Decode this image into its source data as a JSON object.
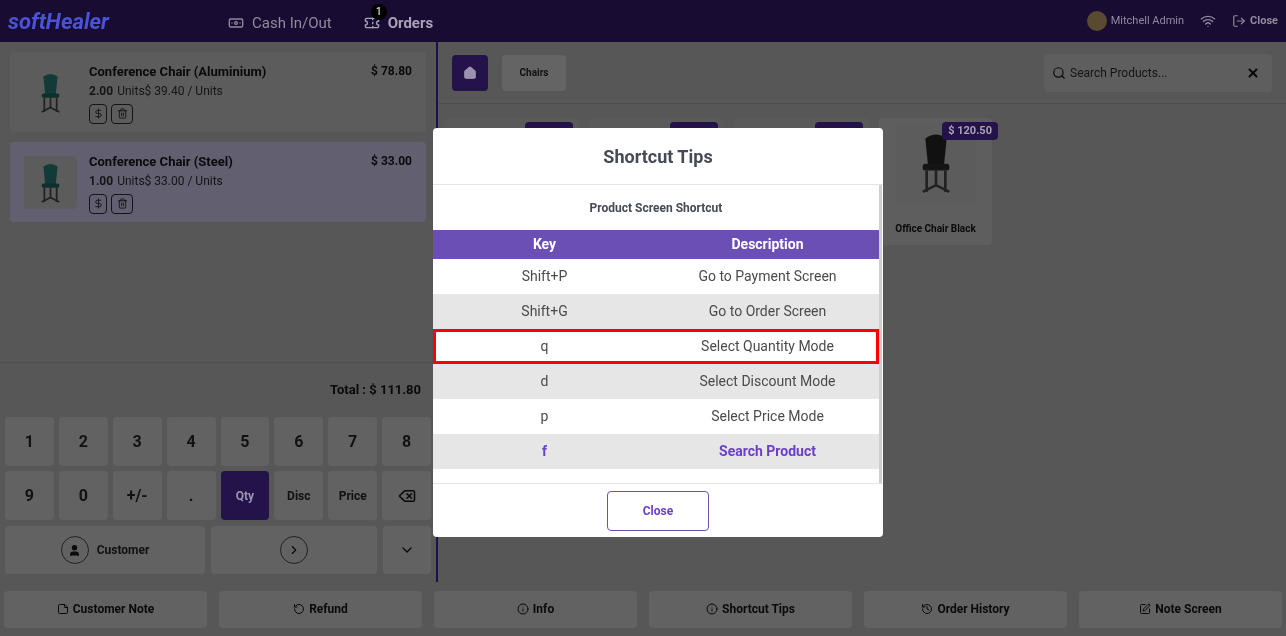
{
  "top_bar": {
    "logo": "softHealer",
    "nav": [
      {
        "label": "Cash In/Out",
        "kind": "cash",
        "active": false
      },
      {
        "label": "Orders",
        "kind": "orders",
        "badge": "1",
        "active": true
      }
    ],
    "user": "Mitchell Admin",
    "close": "Close"
  },
  "order_lines": [
    {
      "name": "Conference Chair (Aluminium)",
      "qty": "2.00",
      "unit_price": "Units$ 39.40 / Units",
      "price": "$ 78.80",
      "selected": false
    },
    {
      "name": "Conference Chair (Steel)",
      "qty": "1.00",
      "unit_price": "Units$ 33.00 / Units",
      "price": "$ 33.00",
      "selected": true
    }
  ],
  "total": "Total : $ 111.80",
  "numpad": [
    {
      "label": "1",
      "kind": "key",
      "selected": false
    },
    {
      "label": "2",
      "kind": "key",
      "selected": false
    },
    {
      "label": "3",
      "kind": "key",
      "selected": false
    },
    {
      "label": "4",
      "kind": "key",
      "selected": false
    },
    {
      "label": "5",
      "kind": "key",
      "selected": false
    },
    {
      "label": "6",
      "kind": "key",
      "selected": false
    },
    {
      "label": "7",
      "kind": "key",
      "selected": false
    },
    {
      "label": "8",
      "kind": "key",
      "selected": false
    },
    {
      "label": "9",
      "kind": "key",
      "selected": false
    },
    {
      "label": "0",
      "kind": "key",
      "selected": false
    },
    {
      "label": "+/-",
      "kind": "key",
      "selected": false
    },
    {
      "label": ".",
      "kind": "key",
      "selected": false
    },
    {
      "label": "Qty",
      "kind": "mode",
      "selected": true
    },
    {
      "label": "Disc",
      "kind": "mode",
      "selected": false
    },
    {
      "label": "Price",
      "kind": "mode",
      "selected": false
    },
    {
      "kind": "backspace",
      "selected": false
    }
  ],
  "customer_button": "Customer",
  "categories": {
    "home_selected": true,
    "items": [
      {
        "label": "Chairs",
        "selected": false
      }
    ]
  },
  "search": {
    "placeholder": "Search Products..."
  },
  "products": [
    {
      "name": "Office Chair Black",
      "price": "$ 120.50"
    }
  ],
  "dialog": {
    "title": "Shortcut Tips",
    "subtitle": "Product Screen Shortcut",
    "columns": [
      "Key",
      "Description"
    ],
    "rows": [
      {
        "key": "Shift+P",
        "description": "Go to Payment Screen",
        "selected": false,
        "highlighted": false
      },
      {
        "key": "Shift+G",
        "description": "Go to Order Screen",
        "selected": false,
        "highlighted": false
      },
      {
        "key": "q",
        "description": "Select Quantity Mode",
        "selected": false,
        "highlighted": true
      },
      {
        "key": "d",
        "description": "Select Discount Mode",
        "selected": false,
        "highlighted": false
      },
      {
        "key": "p",
        "description": "Select Price Mode",
        "selected": false,
        "highlighted": false
      },
      {
        "key": "f",
        "description": "Search Product",
        "selected": true,
        "highlighted": false
      }
    ],
    "close": "Close"
  },
  "action_bar": [
    "Customer Note",
    "Refund",
    "Info",
    "Shortcut Tips",
    "Order History",
    "Note Screen"
  ]
}
